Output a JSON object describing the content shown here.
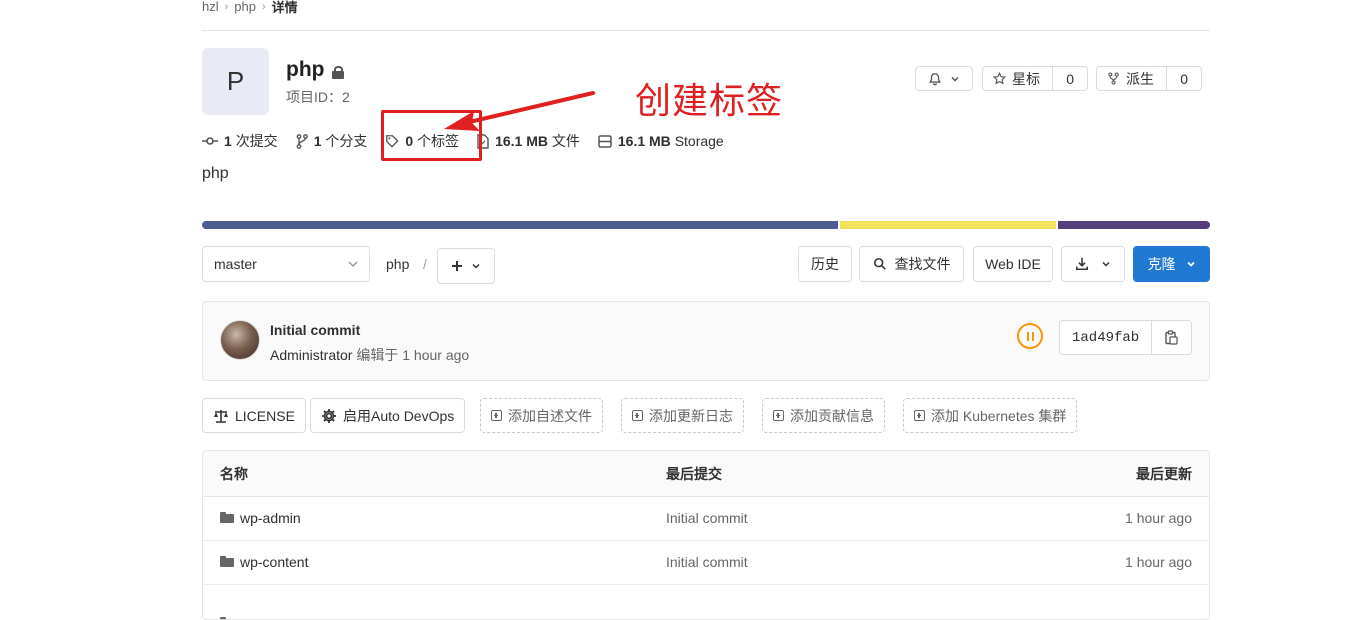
{
  "breadcrumb": {
    "items": [
      "hzl",
      "php"
    ],
    "current": "详情"
  },
  "project": {
    "avatar_letter": "P",
    "name": "php",
    "id_text": "项目ID：2",
    "description": "php"
  },
  "actions": {
    "notifications_icon": "bell-icon",
    "star": {
      "label": "星标",
      "count": "0"
    },
    "fork": {
      "label": "派生",
      "count": "0"
    }
  },
  "stats": {
    "commits": {
      "value": "1",
      "label": "次提交"
    },
    "branches": {
      "value": "1",
      "label": "个分支"
    },
    "tags": {
      "value": "0",
      "label": "个标签"
    },
    "files": {
      "value": "16.1 MB",
      "label": "文件"
    },
    "storage": {
      "value": "16.1 MB",
      "label": "Storage"
    }
  },
  "annotation": {
    "text": "创建标签",
    "color": "#e02020"
  },
  "language_bar": [
    {
      "fraction": 0.633,
      "color": "#4f5d95"
    },
    {
      "fraction": 0.216,
      "color": "#f1e05a"
    },
    {
      "fraction": 0.151,
      "color": "#563d7c"
    }
  ],
  "repo_toolbar": {
    "branch": "master",
    "path_root": "php",
    "path_sep": "/",
    "history_label": "历史",
    "find_file_label": "查找文件",
    "web_ide_label": "Web IDE",
    "clone_label": "克隆",
    "clone_color": "#1f78d1"
  },
  "last_commit": {
    "title": "Initial commit",
    "author": "Administrator",
    "verb": "编辑于",
    "time": "1 hour ago",
    "sha": "1ad49fab",
    "pipeline_color": "#fc9403"
  },
  "quick_actions": [
    {
      "label": "LICENSE",
      "icon": "scale-icon",
      "style": "solid"
    },
    {
      "label": "启用Auto DevOps",
      "icon": "gear-icon",
      "style": "solid"
    },
    {
      "label": "添加自述文件",
      "icon": "plus-square-icon",
      "style": "dashed"
    },
    {
      "label": "添加更新日志",
      "icon": "plus-square-icon",
      "style": "dashed"
    },
    {
      "label": "添加贡献信息",
      "icon": "plus-square-icon",
      "style": "dashed"
    },
    {
      "label": "添加 Kubernetes 集群",
      "icon": "plus-square-icon",
      "style": "dashed"
    }
  ],
  "file_table": {
    "headers": {
      "name": "名称",
      "last_commit": "最后提交",
      "last_update": "最后更新"
    },
    "rows": [
      {
        "name": "wp-admin",
        "commit": "Initial commit",
        "updated": "1 hour ago"
      },
      {
        "name": "wp-content",
        "commit": "Initial commit",
        "updated": "1 hour ago"
      }
    ]
  }
}
